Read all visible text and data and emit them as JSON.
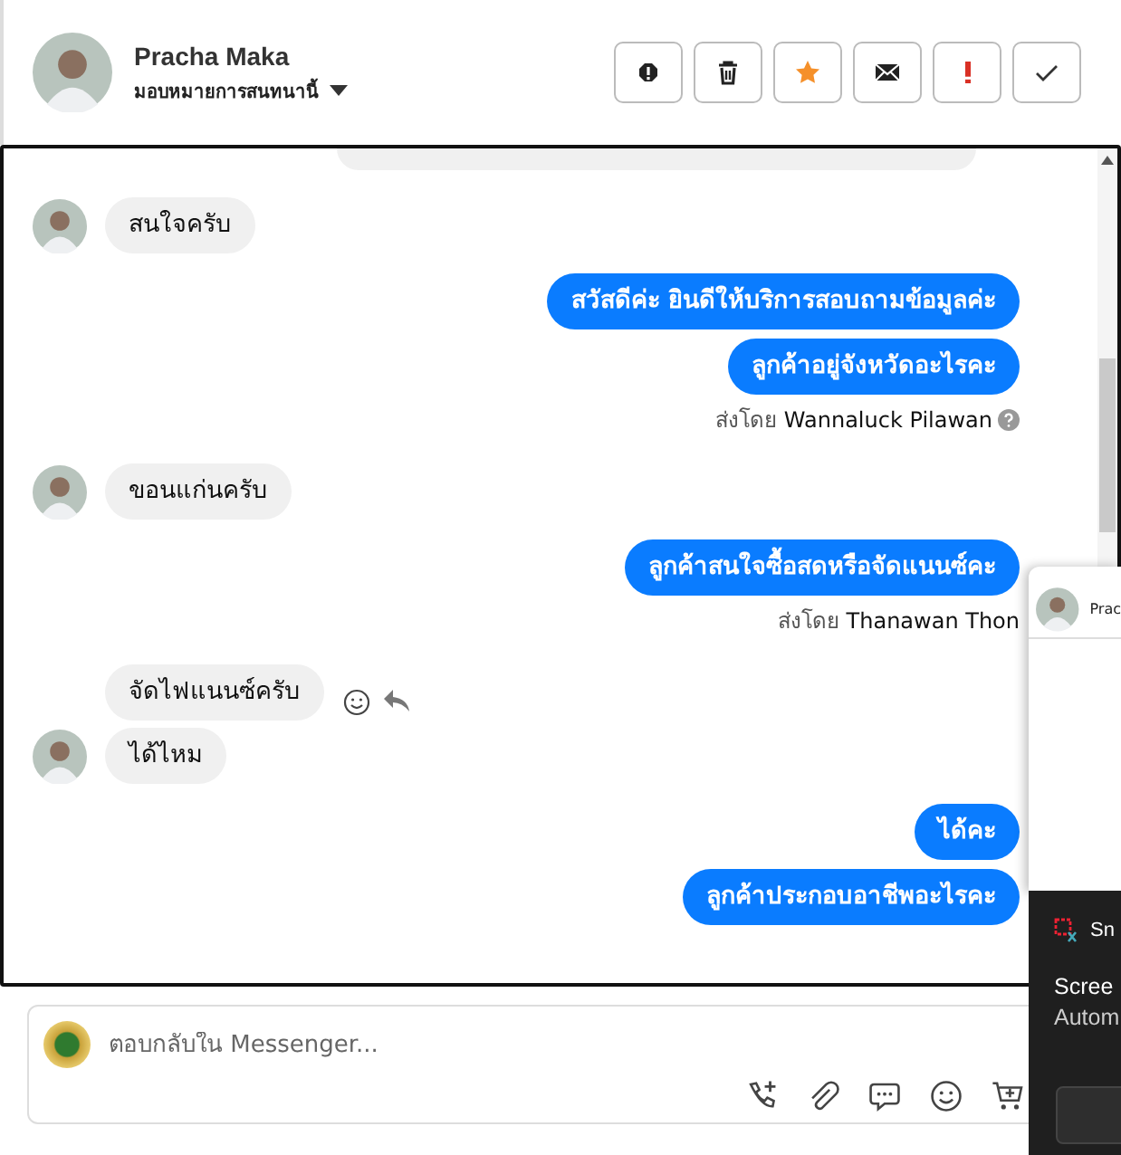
{
  "header": {
    "name": "Pracha Maka",
    "assign_label": "มอบหมายการสนทนานี้",
    "actions": [
      {
        "kind": "spam"
      },
      {
        "kind": "delete"
      },
      {
        "kind": "star"
      },
      {
        "kind": "unread"
      },
      {
        "kind": "important"
      },
      {
        "kind": "done"
      }
    ]
  },
  "thread": {
    "messages": [
      {
        "kind": "cut"
      },
      {
        "kind": "in",
        "text": "สนใจครับ",
        "avatar": true,
        "actions": false
      },
      {
        "kind": "out",
        "text": "สวัสดีค่ะ ยินดีให้บริการสอบถามข้อมูลค่ะ"
      },
      {
        "kind": "out",
        "text": "ลูกค้าอยู่จังหวัดอะไรคะ"
      },
      {
        "kind": "sent_by",
        "text": "ส่งโดย **Wannaluck Pilawan**",
        "info_icon": true
      },
      {
        "kind": "in",
        "text": "ขอนแก่นครับ",
        "avatar": true,
        "actions": false
      },
      {
        "kind": "out",
        "text": "ลูกค้าสนใจซื้อสดหรือจัดแนนซ์คะ"
      },
      {
        "kind": "sent_by",
        "text": "ส่งโดย **Thanawan Thon**",
        "info_icon": false
      },
      {
        "kind": "in",
        "text": "จัดไฟแนนซ์ครับ",
        "avatar": false,
        "actions": true
      },
      {
        "kind": "in",
        "text": "ได้ไหม",
        "avatar": true,
        "actions": false
      },
      {
        "kind": "out",
        "text": "ได้คะ"
      },
      {
        "kind": "out",
        "text": "ลูกค้าประกอบอาชีพอะไรคะ"
      }
    ]
  },
  "composer": {
    "placeholder": "ตอบกลับใน Messenger...",
    "tools": [
      {
        "kind": "call"
      },
      {
        "kind": "attach"
      },
      {
        "kind": "quick_reply"
      },
      {
        "kind": "emoji"
      },
      {
        "kind": "cart"
      }
    ]
  },
  "popup": {
    "name": "Prac"
  },
  "toast": {
    "app": "Sn",
    "title": "Scree",
    "body": "Autom"
  }
}
